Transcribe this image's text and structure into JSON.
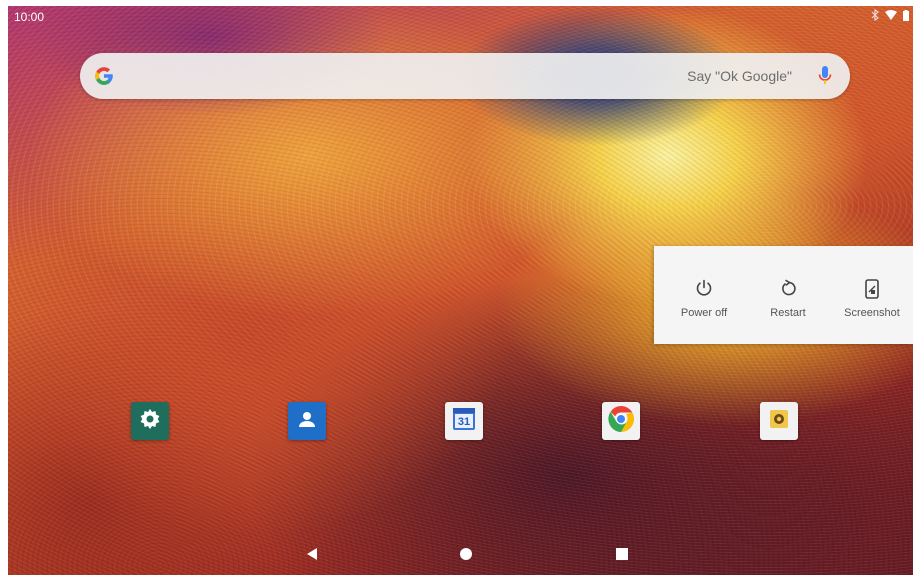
{
  "status_bar": {
    "time": "10:00",
    "icons": [
      "bluetooth-icon",
      "wifi-icon",
      "battery-icon"
    ]
  },
  "search": {
    "logo_letter": "G",
    "hint": "Say \"Ok Google\"",
    "icons": [
      "google-g-icon",
      "mic-icon"
    ]
  },
  "power_menu": {
    "items": [
      {
        "label": "Power off",
        "icon": "power-icon"
      },
      {
        "label": "Restart",
        "icon": "restart-icon"
      },
      {
        "label": "Screenshot",
        "icon": "screenshot-icon"
      }
    ]
  },
  "dock": {
    "apps": [
      {
        "name": "Settings",
        "icon": "settings-icon",
        "color": "#1f6e5d"
      },
      {
        "name": "Contacts",
        "icon": "contacts-icon",
        "color": "#1f6fc9"
      },
      {
        "name": "Calendar",
        "icon": "calendar-icon",
        "color": "#3b73d6",
        "day": "31"
      },
      {
        "name": "Chrome",
        "icon": "chrome-icon",
        "color": "#f2f2f2"
      },
      {
        "name": "Camera",
        "icon": "camera-icon",
        "color": "#f0c74a"
      }
    ]
  },
  "nav": {
    "buttons": [
      "back-button",
      "home-button",
      "recents-button"
    ]
  },
  "colors": {
    "google_blue": "#4285F4",
    "google_red": "#EA4335",
    "google_yellow": "#FBBC05",
    "google_green": "#34A853",
    "menu_bg": "#f5f5f5"
  }
}
